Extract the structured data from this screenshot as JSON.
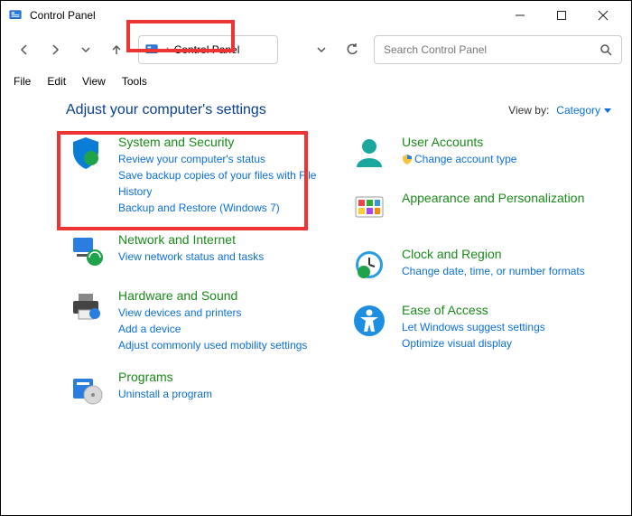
{
  "window": {
    "title": "Control Panel"
  },
  "breadcrumb": {
    "root": "Control Panel"
  },
  "search": {
    "placeholder": "Search Control Panel"
  },
  "menu": {
    "file": "File",
    "edit": "Edit",
    "view": "View",
    "tools": "Tools"
  },
  "heading": "Adjust your computer's settings",
  "viewby": {
    "label": "View by:",
    "value": "Category"
  },
  "cats": {
    "system": {
      "title": "System and Security",
      "l1": "Review your computer's status",
      "l2": "Save backup copies of your files with File History",
      "l3": "Backup and Restore (Windows 7)"
    },
    "network": {
      "title": "Network and Internet",
      "l1": "View network status and tasks"
    },
    "hardware": {
      "title": "Hardware and Sound",
      "l1": "View devices and printers",
      "l2": "Add a device",
      "l3": "Adjust commonly used mobility settings"
    },
    "programs": {
      "title": "Programs",
      "l1": "Uninstall a program"
    },
    "users": {
      "title": "User Accounts",
      "l1": "Change account type"
    },
    "appearance": {
      "title": "Appearance and Personalization"
    },
    "clock": {
      "title": "Clock and Region",
      "l1": "Change date, time, or number formats"
    },
    "ease": {
      "title": "Ease of Access",
      "l1": "Let Windows suggest settings",
      "l2": "Optimize visual display"
    }
  }
}
